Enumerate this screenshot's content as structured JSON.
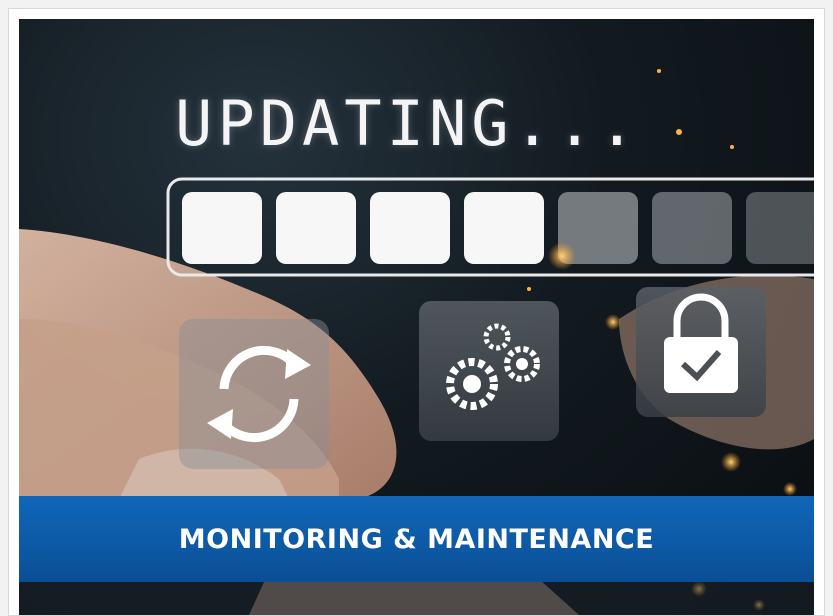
{
  "image": {
    "overlay_text": "UPDATING...",
    "progress": {
      "filled_segments": 4,
      "total_segments": 7
    },
    "icons": [
      "refresh-icon",
      "gears-icon",
      "lock-check-icon"
    ]
  },
  "banner": {
    "title": "MONITORING & MAINTENANCE",
    "color": "#0d5aa6"
  }
}
